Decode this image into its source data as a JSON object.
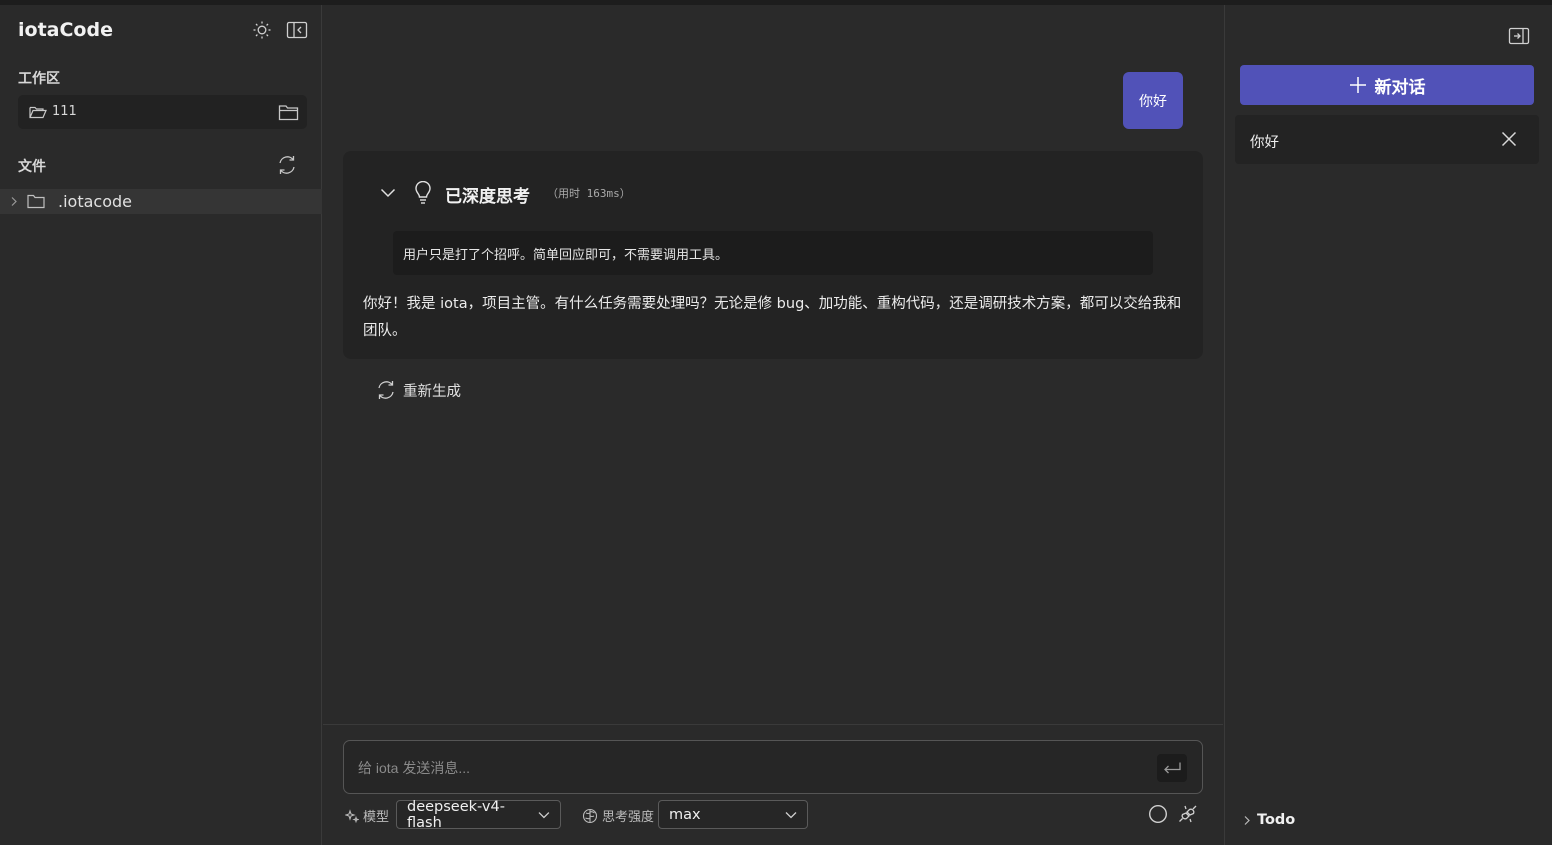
{
  "app": {
    "title": "iotaCode"
  },
  "sidebar": {
    "workspace_label": "工作区",
    "workspace_name": "111",
    "files_label": "文件",
    "tree": [
      {
        "name": ".iotacode",
        "type": "folder"
      }
    ]
  },
  "chat": {
    "user_message": "你好",
    "thinking": {
      "title": "已深度思考",
      "time": "（用时 163ms）",
      "content": "用户只是打了个招呼。简单回应即可，不需要调用工具。"
    },
    "reply": "你好！我是 iota，项目主管。有什么任务需要处理吗？无论是修 bug、加功能、重构代码，还是调研技术方案，都可以交给我和团队。",
    "regenerate_label": "重新生成"
  },
  "input": {
    "placeholder": "给 iota 发送消息...",
    "model_label": "模型",
    "model_value": "deepseek-v4-flash",
    "effort_label": "思考强度",
    "effort_value": "max"
  },
  "right_panel": {
    "new_chat_label": "新对话",
    "conversations": [
      {
        "title": "你好"
      }
    ],
    "todo_label": "Todo"
  },
  "colors": {
    "accent": "#5152b8",
    "background": "#2a2a2a",
    "card": "#232323"
  },
  "icons": [
    "sun-icon",
    "collapse-sidebar-icon",
    "folder-open-icon",
    "folder-icon",
    "refresh-icon",
    "chevron-right-icon",
    "chevron-down-icon",
    "lightbulb-icon",
    "enter-icon",
    "sparkle-icon",
    "brain-icon",
    "circle-icon",
    "plug-icon",
    "expand-panel-icon",
    "plus-icon",
    "close-icon"
  ]
}
